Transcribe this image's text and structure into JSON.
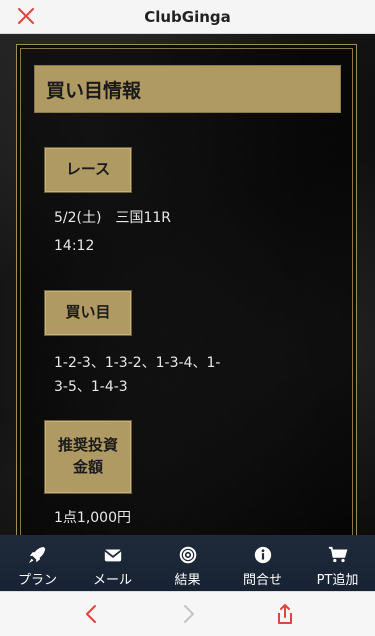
{
  "header": {
    "title": "ClubGinga"
  },
  "section": {
    "title": "買い目情報"
  },
  "race": {
    "label": "レース",
    "date_venue": "5/2(土)　三国11R",
    "time": "14:12"
  },
  "bets": {
    "label": "買い目",
    "combinations": "1-2-3、1-3-2、1-3-4、1-\n3-5、1-4-3"
  },
  "amount": {
    "label": "推奨投資\n金額",
    "value": "1点1,000円"
  },
  "tabbar": {
    "items": [
      {
        "label": "プラン",
        "icon": "rocket-icon"
      },
      {
        "label": "メール",
        "icon": "envelope-icon"
      },
      {
        "label": "結果",
        "icon": "target-icon"
      },
      {
        "label": "問合せ",
        "icon": "info-icon"
      },
      {
        "label": "PT追加",
        "icon": "cart-icon"
      }
    ]
  },
  "colors": {
    "accent": "#b09a63",
    "tabbar": "#1f2a3a",
    "browser_red": "#e0443e"
  }
}
